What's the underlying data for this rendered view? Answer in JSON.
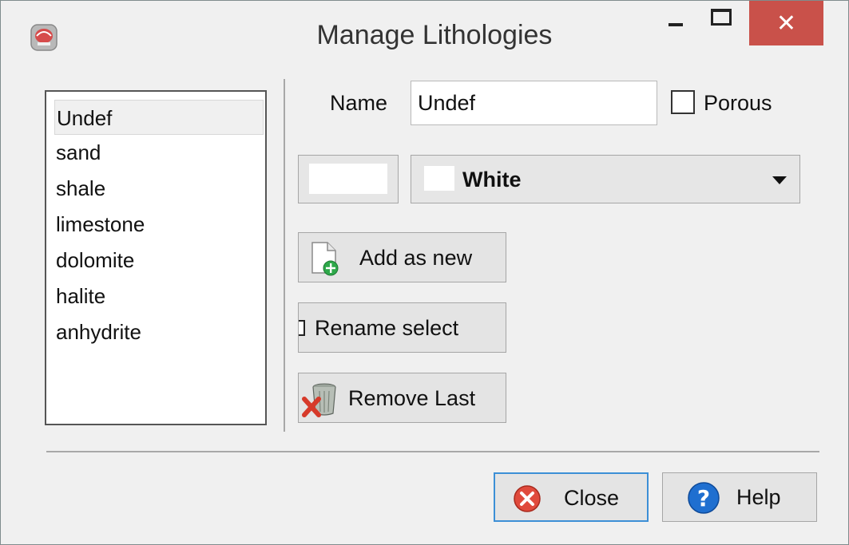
{
  "window": {
    "title": "Manage Lithologies",
    "close_glyph": "✕"
  },
  "lithologies": {
    "items": [
      "Undef",
      "sand",
      "shale",
      "limestone",
      "dolomite",
      "halite",
      "anhydrite"
    ],
    "selected_index": 0
  },
  "form": {
    "name_label": "Name",
    "name_value": "Undef",
    "porous_label": "Porous",
    "porous_checked": false,
    "color_value": "White",
    "swatch_color": "#ffffff"
  },
  "actions": {
    "add_label": "Add as new",
    "add_icon": "new-document-icon",
    "rename_label": "Rename select",
    "rename_icon": "rename-icon",
    "remove_label": "Remove Last",
    "remove_icon": "trash-remove-icon"
  },
  "footer": {
    "close_label": "Close",
    "close_icon": "close-circle-icon",
    "help_label": "Help",
    "help_icon": "help-circle-icon"
  },
  "colors": {
    "titlebar_close": "#c9514a",
    "default_button_border": "#3c8fd6"
  }
}
